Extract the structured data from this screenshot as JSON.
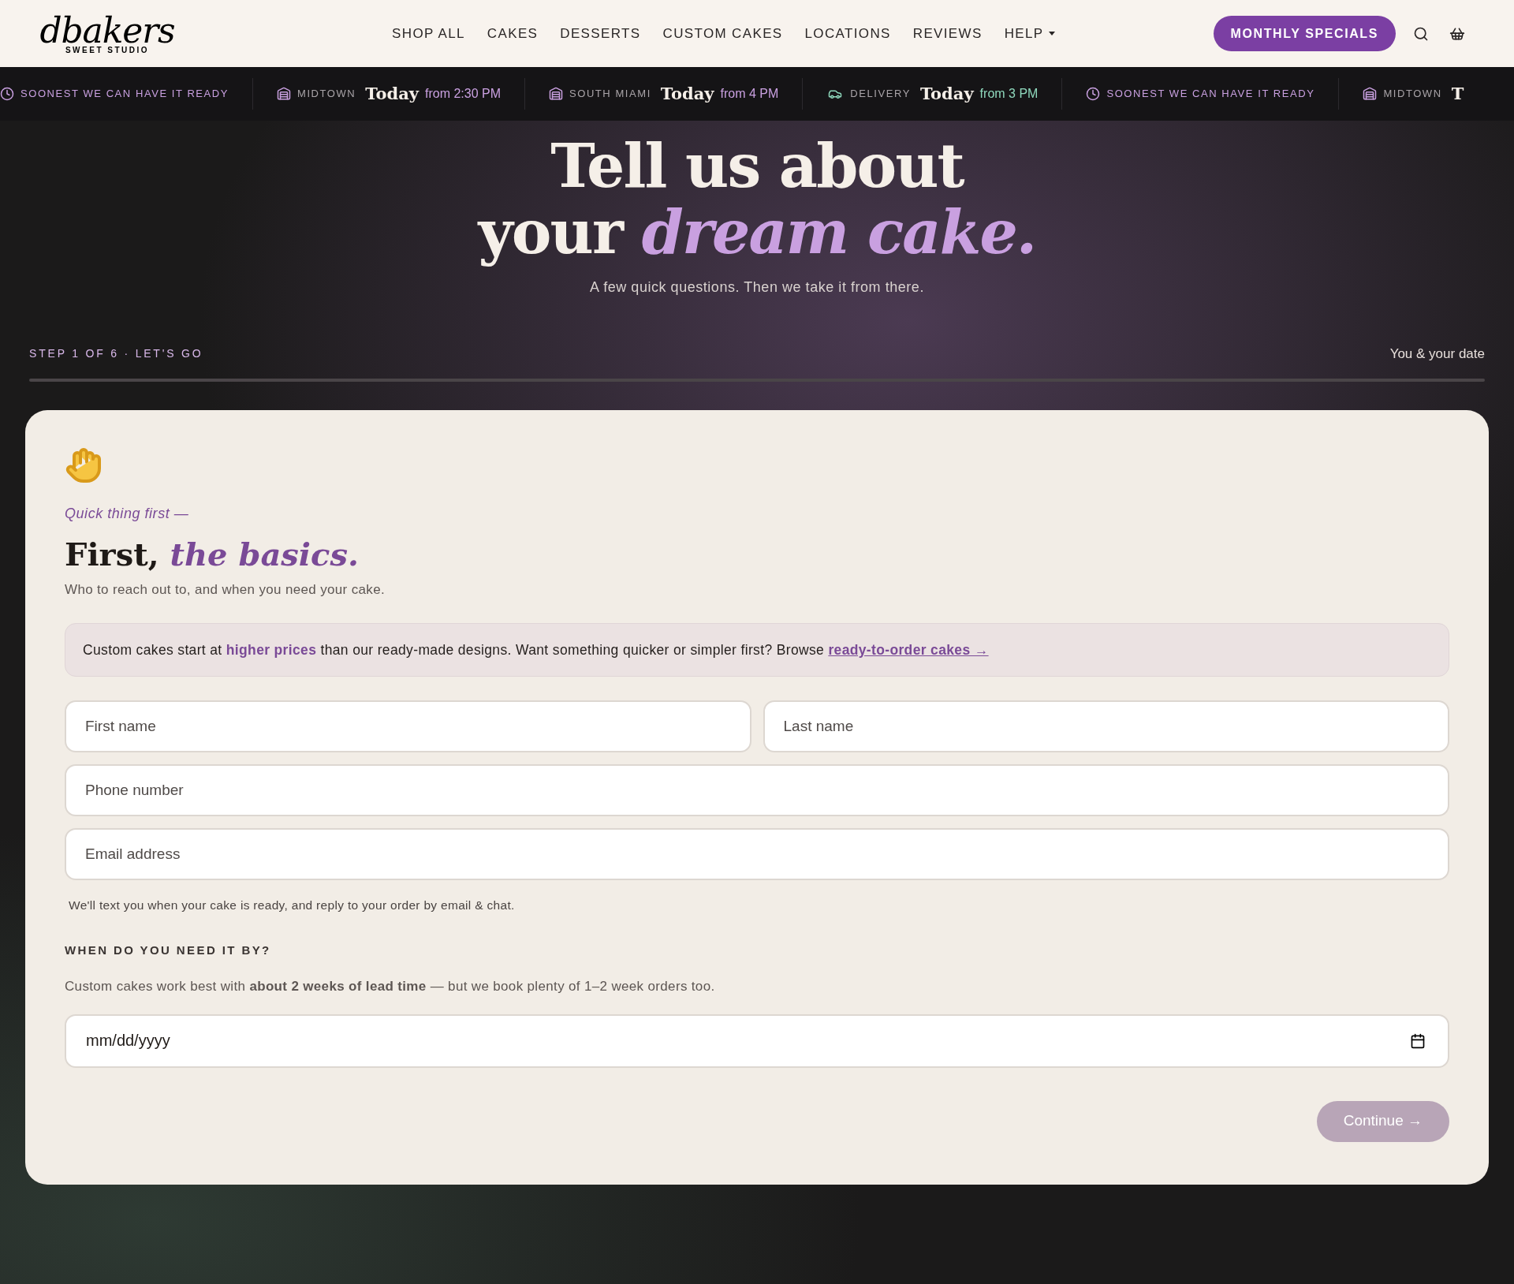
{
  "header": {
    "logo": {
      "wordmark": "dbakers",
      "tagline": "SWEET STUDIO"
    },
    "nav": [
      {
        "label": "SHOP ALL",
        "dropdown": false
      },
      {
        "label": "CAKES",
        "dropdown": false
      },
      {
        "label": "DESSERTS",
        "dropdown": false
      },
      {
        "label": "CUSTOM CAKES",
        "dropdown": false
      },
      {
        "label": "LOCATIONS",
        "dropdown": false
      },
      {
        "label": "REVIEWS",
        "dropdown": false
      },
      {
        "label": "HELP",
        "dropdown": true
      }
    ],
    "cta": "MONTHLY SPECIALS"
  },
  "ticker": [
    {
      "kind": "soonest",
      "label": "SOONEST WE CAN HAVE IT READY"
    },
    {
      "kind": "location",
      "label": "MIDTOWN",
      "day": "Today",
      "time": "from 2:30 PM"
    },
    {
      "kind": "location",
      "label": "SOUTH MIAMI",
      "day": "Today",
      "time": "from 4 PM"
    },
    {
      "kind": "delivery",
      "label": "DELIVERY",
      "day": "Today",
      "time": "from 3 PM"
    },
    {
      "kind": "soonest",
      "label": "SOONEST WE CAN HAVE IT READY"
    },
    {
      "kind": "location",
      "label": "MIDTOWN",
      "day": "T"
    }
  ],
  "hero": {
    "title_line_1": "Tell us about",
    "title_line_2": "your *dream cake.*",
    "subtitle": "A few quick questions. Then we take it from there."
  },
  "progress": {
    "step": "STEP 1 OF 6 · LET'S GO",
    "section": "You & your date"
  },
  "card": {
    "eyebrow": "Quick thing first —",
    "heading": "First, *the basics.*",
    "subheading": "Who to reach out to, and when you need your cake.",
    "notice": {
      "text": "Custom cakes start at **higher prices** than our ready-made designs. Want something quicker or simpler first? Browse ",
      "link": "ready-to-order cakes →"
    },
    "fields": [
      {
        "placeholder": "First name",
        "half": true
      },
      {
        "placeholder": "Last name",
        "half": true
      },
      {
        "placeholder": "Phone number",
        "half": false
      },
      {
        "placeholder": "Email address",
        "half": false
      }
    ],
    "helper": "We'll text you when your cake is ready, and reply to your order by email & chat.",
    "date_label": "WHEN DO YOU NEED IT BY?",
    "date_hint": "Custom cakes work best with **about 2 weeks of lead time** — but we book plenty of 1–2 week orders too.",
    "date_placeholder": "mm/dd/yyyy",
    "continue": {
      "label": "Continue →",
      "disabled": true
    }
  }
}
